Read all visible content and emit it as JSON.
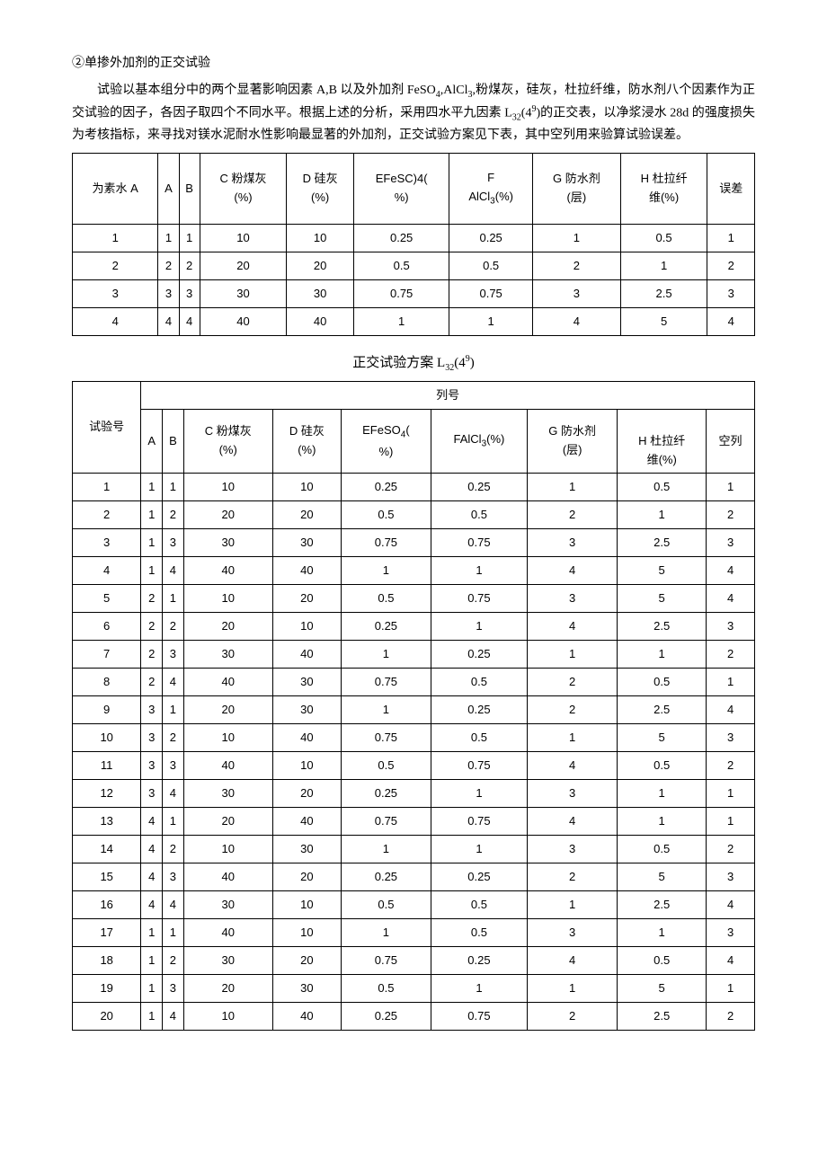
{
  "heading": "②单掺外加剂的正交试验",
  "paragraph": "试验以基本组分中的两个显著影响因素 A,B 以及外加剂 FeSO4,AlCl3,粉煤灰，硅灰，杜拉纤维，防水剂八个因素作为正交试验的因子，各因子取四个不同水平。根据上述的分析，采用四水平九因素 L32(4⁹)的正交表，以净浆浸水 28d 的强度损失为考核指标，来寻找对镁水泥耐水性影响最显著的外加剂，正交试验方案见下表，其中空列用来验算试验误差。",
  "table1": {
    "headers": [
      "为素水 A",
      "A",
      "B",
      "C 粉煤灰(%)",
      "D 硅灰(%)",
      "E FeSO4(%)",
      "F AlCl3(%)",
      "G 防水剂(层)",
      "H 杜拉纤维(%)",
      "误差"
    ],
    "rows": [
      [
        "1",
        "1",
        "1",
        "10",
        "10",
        "0.25",
        "0.25",
        "1",
        "0.5",
        "1"
      ],
      [
        "2",
        "2",
        "2",
        "20",
        "20",
        "0.5",
        "0.5",
        "2",
        "1",
        "2"
      ],
      [
        "3",
        "3",
        "3",
        "30",
        "30",
        "0.75",
        "0.75",
        "3",
        "2.5",
        "3"
      ],
      [
        "4",
        "4",
        "4",
        "40",
        "40",
        "1",
        "1",
        "4",
        "5",
        "4"
      ]
    ]
  },
  "caption": "正交试验方案 L32(4⁹)",
  "table2": {
    "top_header": "列号",
    "row_header": "试验号",
    "col_headers": [
      "A",
      "B",
      "C 粉煤灰(%)",
      "D 硅灰(%)",
      "E FeSO4(%)",
      "F AlCl3(%)",
      "G 防水剂(层)",
      "H 杜拉纤维(%)",
      "空列"
    ],
    "rows": [
      [
        "1",
        "1",
        "1",
        "10",
        "10",
        "0.25",
        "0.25",
        "1",
        "0.5",
        "1"
      ],
      [
        "2",
        "1",
        "2",
        "20",
        "20",
        "0.5",
        "0.5",
        "2",
        "1",
        "2"
      ],
      [
        "3",
        "1",
        "3",
        "30",
        "30",
        "0.75",
        "0.75",
        "3",
        "2.5",
        "3"
      ],
      [
        "4",
        "1",
        "4",
        "40",
        "40",
        "1",
        "1",
        "4",
        "5",
        "4"
      ],
      [
        "5",
        "2",
        "1",
        "10",
        "20",
        "0.5",
        "0.75",
        "3",
        "5",
        "4"
      ],
      [
        "6",
        "2",
        "2",
        "20",
        "10",
        "0.25",
        "1",
        "4",
        "2.5",
        "3"
      ],
      [
        "7",
        "2",
        "3",
        "30",
        "40",
        "1",
        "0.25",
        "1",
        "1",
        "2"
      ],
      [
        "8",
        "2",
        "4",
        "40",
        "30",
        "0.75",
        "0.5",
        "2",
        "0.5",
        "1"
      ],
      [
        "9",
        "3",
        "1",
        "20",
        "30",
        "1",
        "0.25",
        "2",
        "2.5",
        "4"
      ],
      [
        "10",
        "3",
        "2",
        "10",
        "40",
        "0.75",
        "0.5",
        "1",
        "5",
        "3"
      ],
      [
        "11",
        "3",
        "3",
        "40",
        "10",
        "0.5",
        "0.75",
        "4",
        "0.5",
        "2"
      ],
      [
        "12",
        "3",
        "4",
        "30",
        "20",
        "0.25",
        "1",
        "3",
        "1",
        "1"
      ],
      [
        "13",
        "4",
        "1",
        "20",
        "40",
        "0.75",
        "0.75",
        "4",
        "1",
        "1"
      ],
      [
        "14",
        "4",
        "2",
        "10",
        "30",
        "1",
        "1",
        "3",
        "0.5",
        "2"
      ],
      [
        "15",
        "4",
        "3",
        "40",
        "20",
        "0.25",
        "0.25",
        "2",
        "5",
        "3"
      ],
      [
        "16",
        "4",
        "4",
        "30",
        "10",
        "0.5",
        "0.5",
        "1",
        "2.5",
        "4"
      ],
      [
        "17",
        "1",
        "1",
        "40",
        "10",
        "1",
        "0.5",
        "3",
        "1",
        "3"
      ],
      [
        "18",
        "1",
        "2",
        "30",
        "20",
        "0.75",
        "0.25",
        "4",
        "0.5",
        "4"
      ],
      [
        "19",
        "1",
        "3",
        "20",
        "30",
        "0.5",
        "1",
        "1",
        "5",
        "1"
      ],
      [
        "20",
        "1",
        "4",
        "10",
        "40",
        "0.25",
        "0.75",
        "2",
        "2.5",
        "2"
      ]
    ]
  }
}
